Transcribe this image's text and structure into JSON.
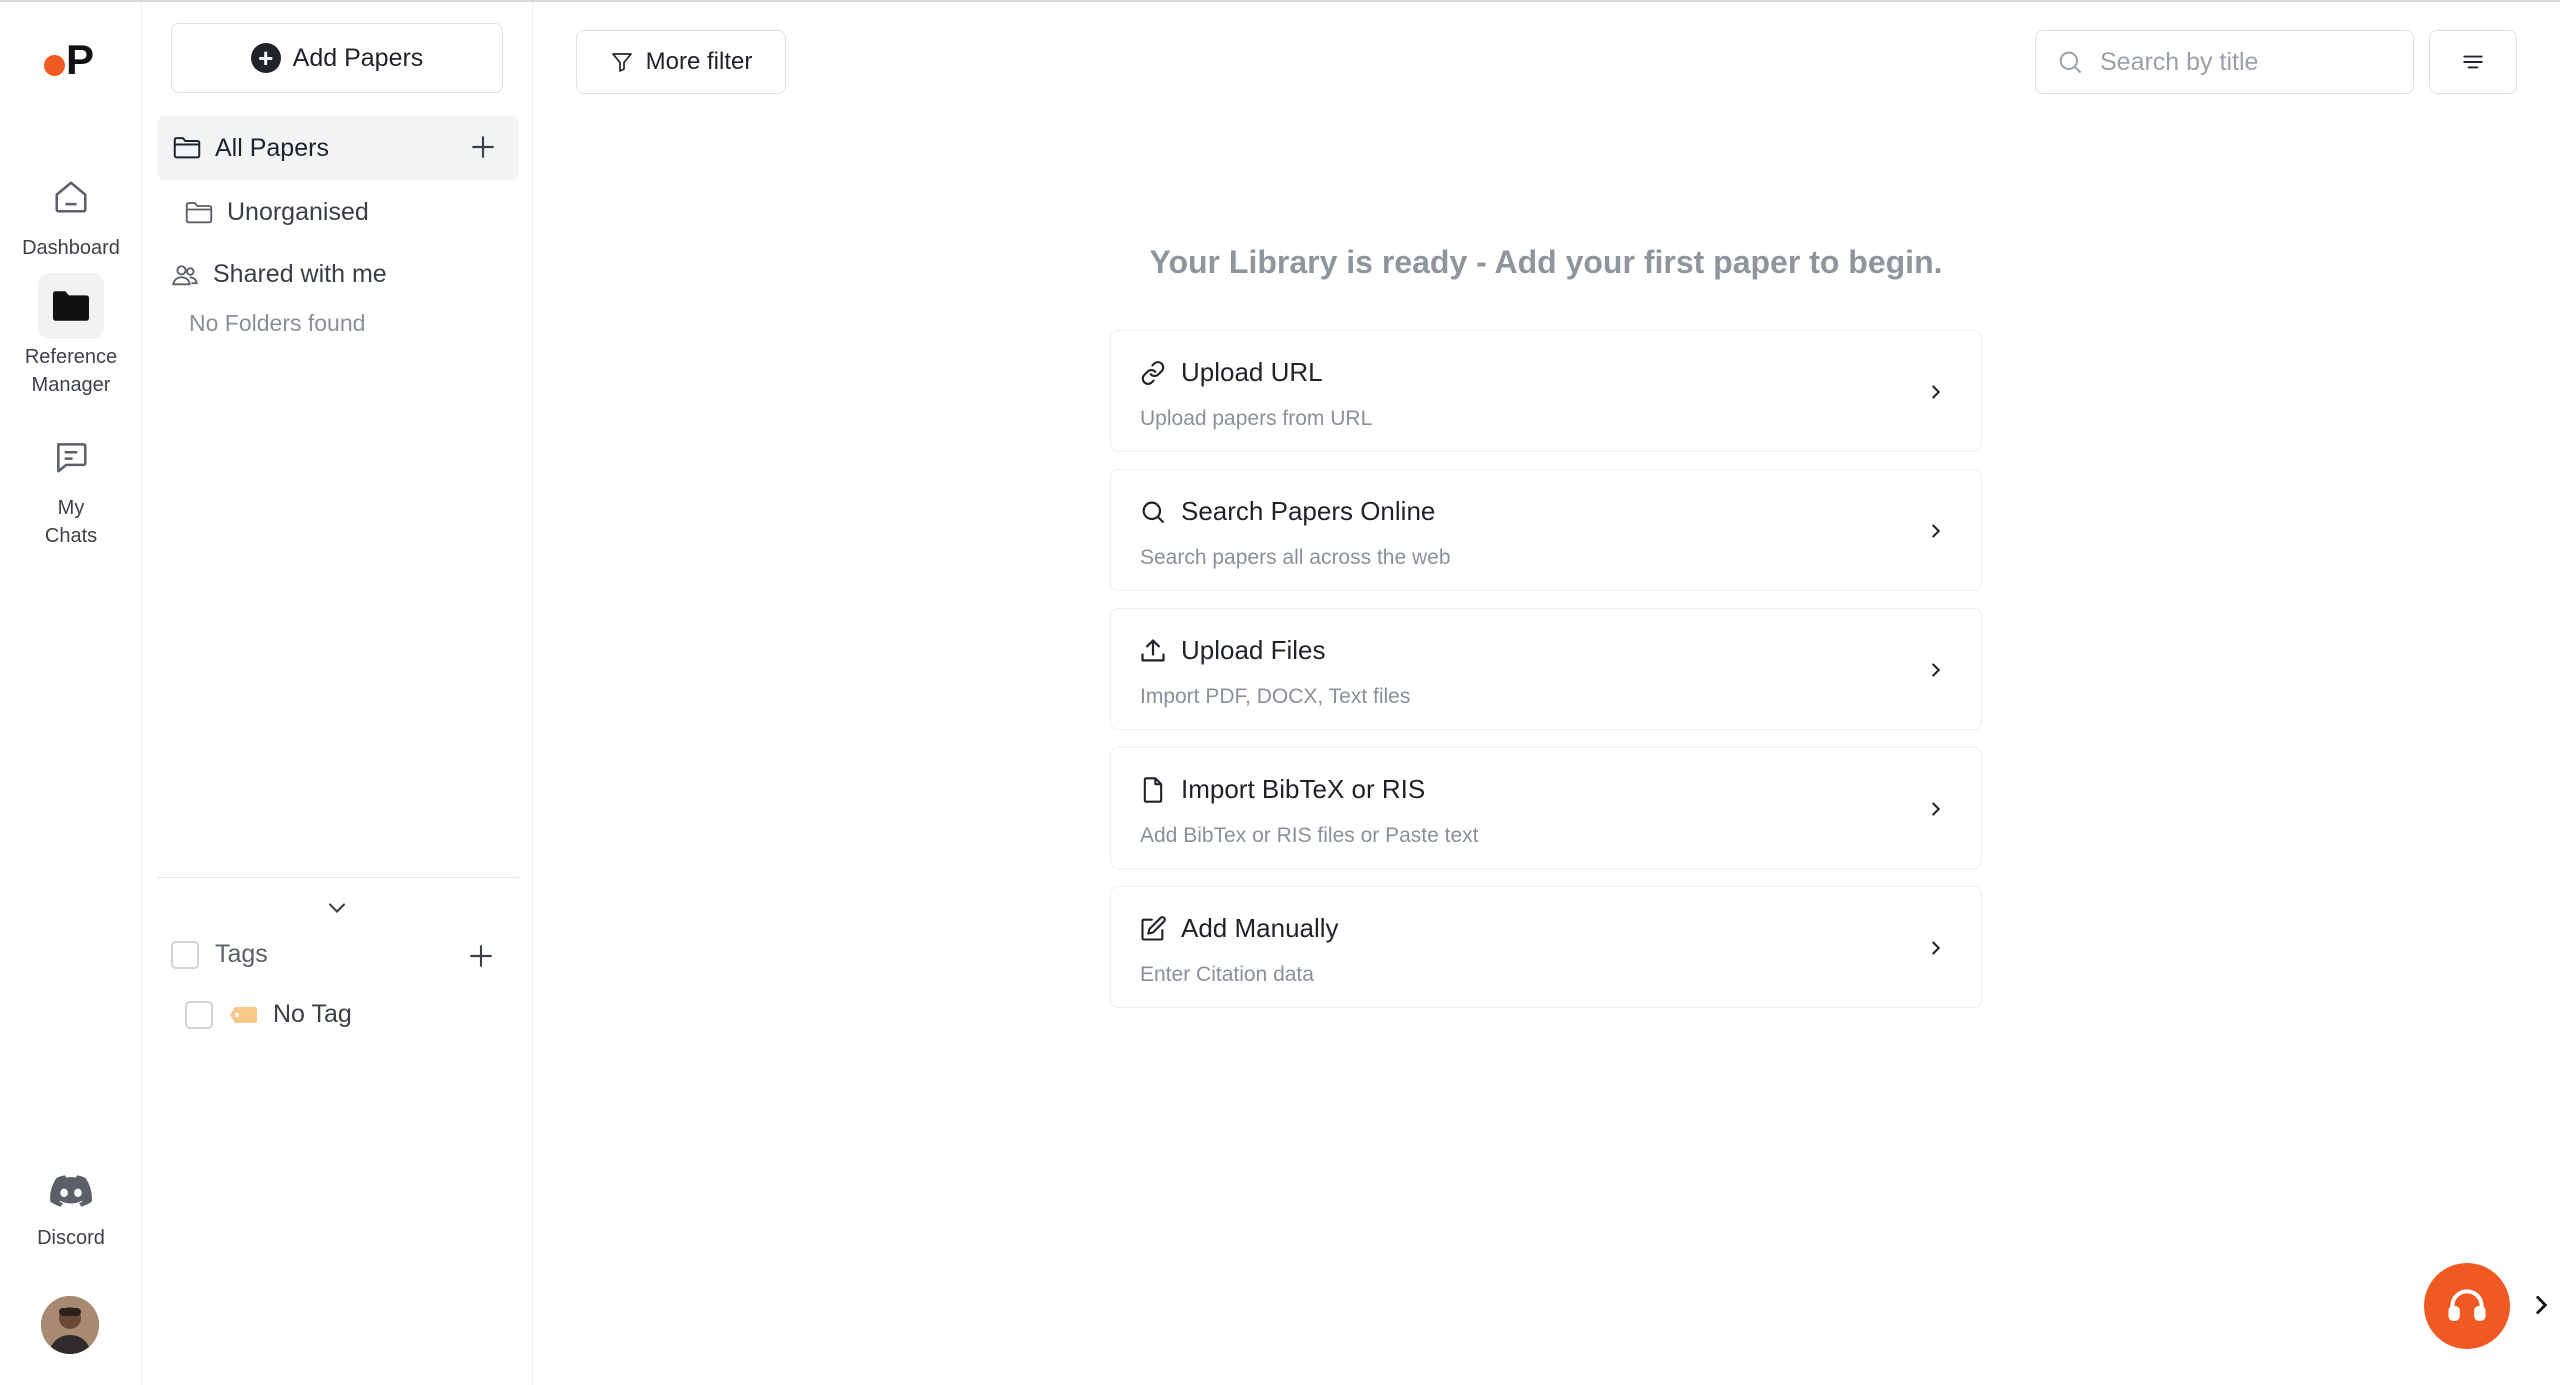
{
  "brand": {
    "logo_letter": "P",
    "accent": "#f05a22"
  },
  "rail": {
    "items": [
      {
        "label": "Dashboard",
        "icon": "home-icon"
      },
      {
        "label_line1": "Reference",
        "label_line2": "Manager",
        "icon": "folder-icon",
        "active": true
      },
      {
        "label_line1": "My",
        "label_line2": "Chats",
        "icon": "chat-icon"
      }
    ],
    "discord": {
      "label": "Discord",
      "icon": "discord-icon"
    }
  },
  "panel": {
    "add_papers_label": "Add Papers",
    "all_papers_label": "All Papers",
    "unorganised_label": "Unorganised",
    "shared_label": "Shared with me",
    "no_folders_label": "No Folders found",
    "tags_label": "Tags",
    "no_tag_label": "No Tag"
  },
  "main": {
    "more_filter_label": "More filter",
    "search_placeholder": "Search by title",
    "empty_title": "Your Library is ready - Add your first paper to begin.",
    "options": [
      {
        "title": "Upload URL",
        "subtitle": "Upload papers from URL",
        "icon": "link-icon"
      },
      {
        "title": "Search Papers Online",
        "subtitle": "Search papers all across the web",
        "icon": "search-icon"
      },
      {
        "title": "Upload Files",
        "subtitle": "Import PDF, DOCX, Text files",
        "icon": "upload-icon"
      },
      {
        "title": "Import BibTeX or RIS",
        "subtitle": "Add BibTex or RIS files or Paste text",
        "icon": "file-icon"
      },
      {
        "title": "Add Manually",
        "subtitle": "Enter Citation data",
        "icon": "edit-icon"
      }
    ]
  }
}
